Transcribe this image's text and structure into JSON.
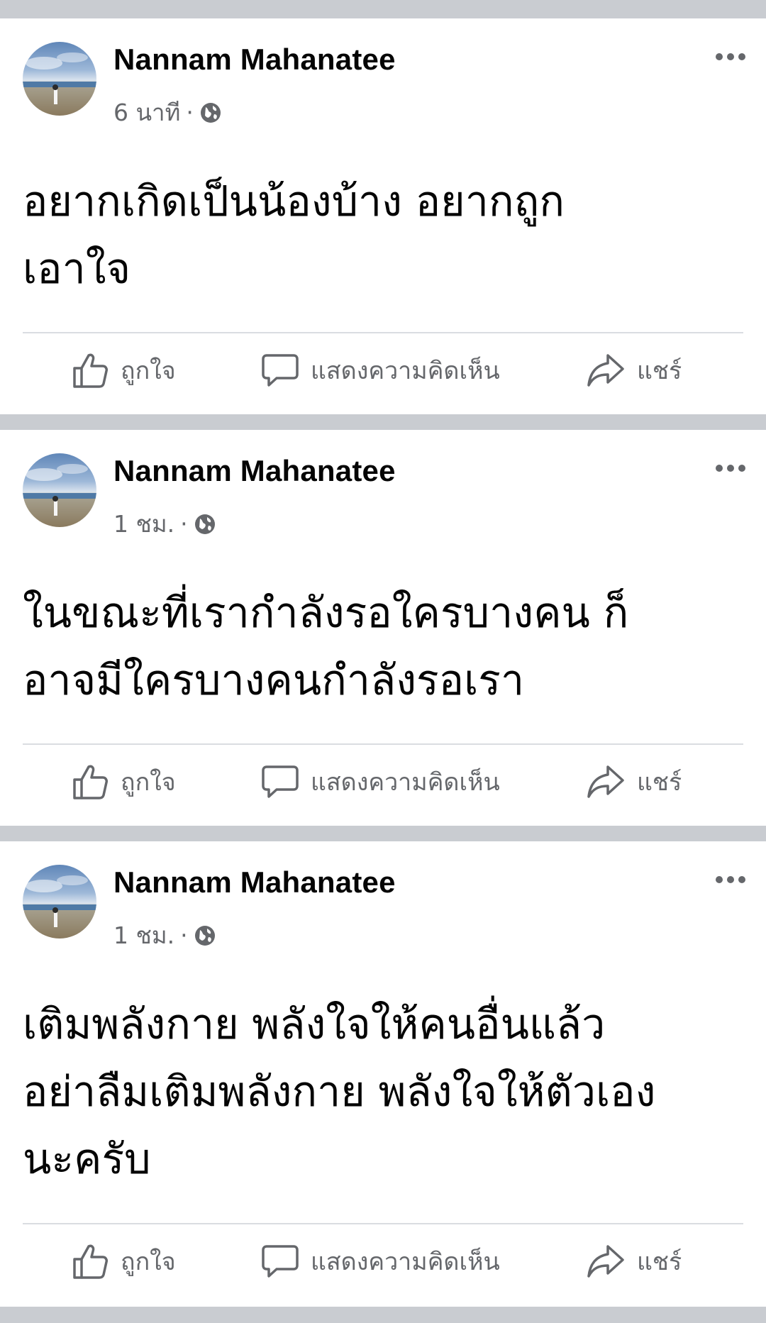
{
  "posts": [
    {
      "author": "Nannam Mahanatee",
      "time": "6 นาที",
      "separator": "·",
      "privacy_icon": "globe-icon",
      "text": "อยากเกิดเป็นน้องบ้าง อยากถูก\nเอาใจ",
      "actions": {
        "like": "ถูกใจ",
        "comment": "แสดงความคิดเห็น",
        "share": "แชร์"
      }
    },
    {
      "author": "Nannam Mahanatee",
      "time": "1 ชม.",
      "separator": "·",
      "privacy_icon": "globe-icon",
      "text": "ในขณะที่เรากำลังรอใครบางคน ก็\nอาจมีใครบางคนกำลังรอเรา",
      "actions": {
        "like": "ถูกใจ",
        "comment": "แสดงความคิดเห็น",
        "share": "แชร์"
      }
    },
    {
      "author": "Nannam Mahanatee",
      "time": "1 ชม.",
      "separator": "·",
      "privacy_icon": "globe-icon",
      "text": "เติมพลังกาย พลังใจให้คนอื่นแล้ว\nอย่าลืมเติมพลังกาย พลังใจให้ตัวเอง\nนะครับ",
      "actions": {
        "like": "ถูกใจ",
        "comment": "แสดงความคิดเห็น",
        "share": "แชร์"
      }
    }
  ],
  "colors": {
    "feed_background": "#c9ccd1",
    "card_background": "#ffffff",
    "primary_text": "#050505",
    "secondary_text": "#65676b"
  }
}
